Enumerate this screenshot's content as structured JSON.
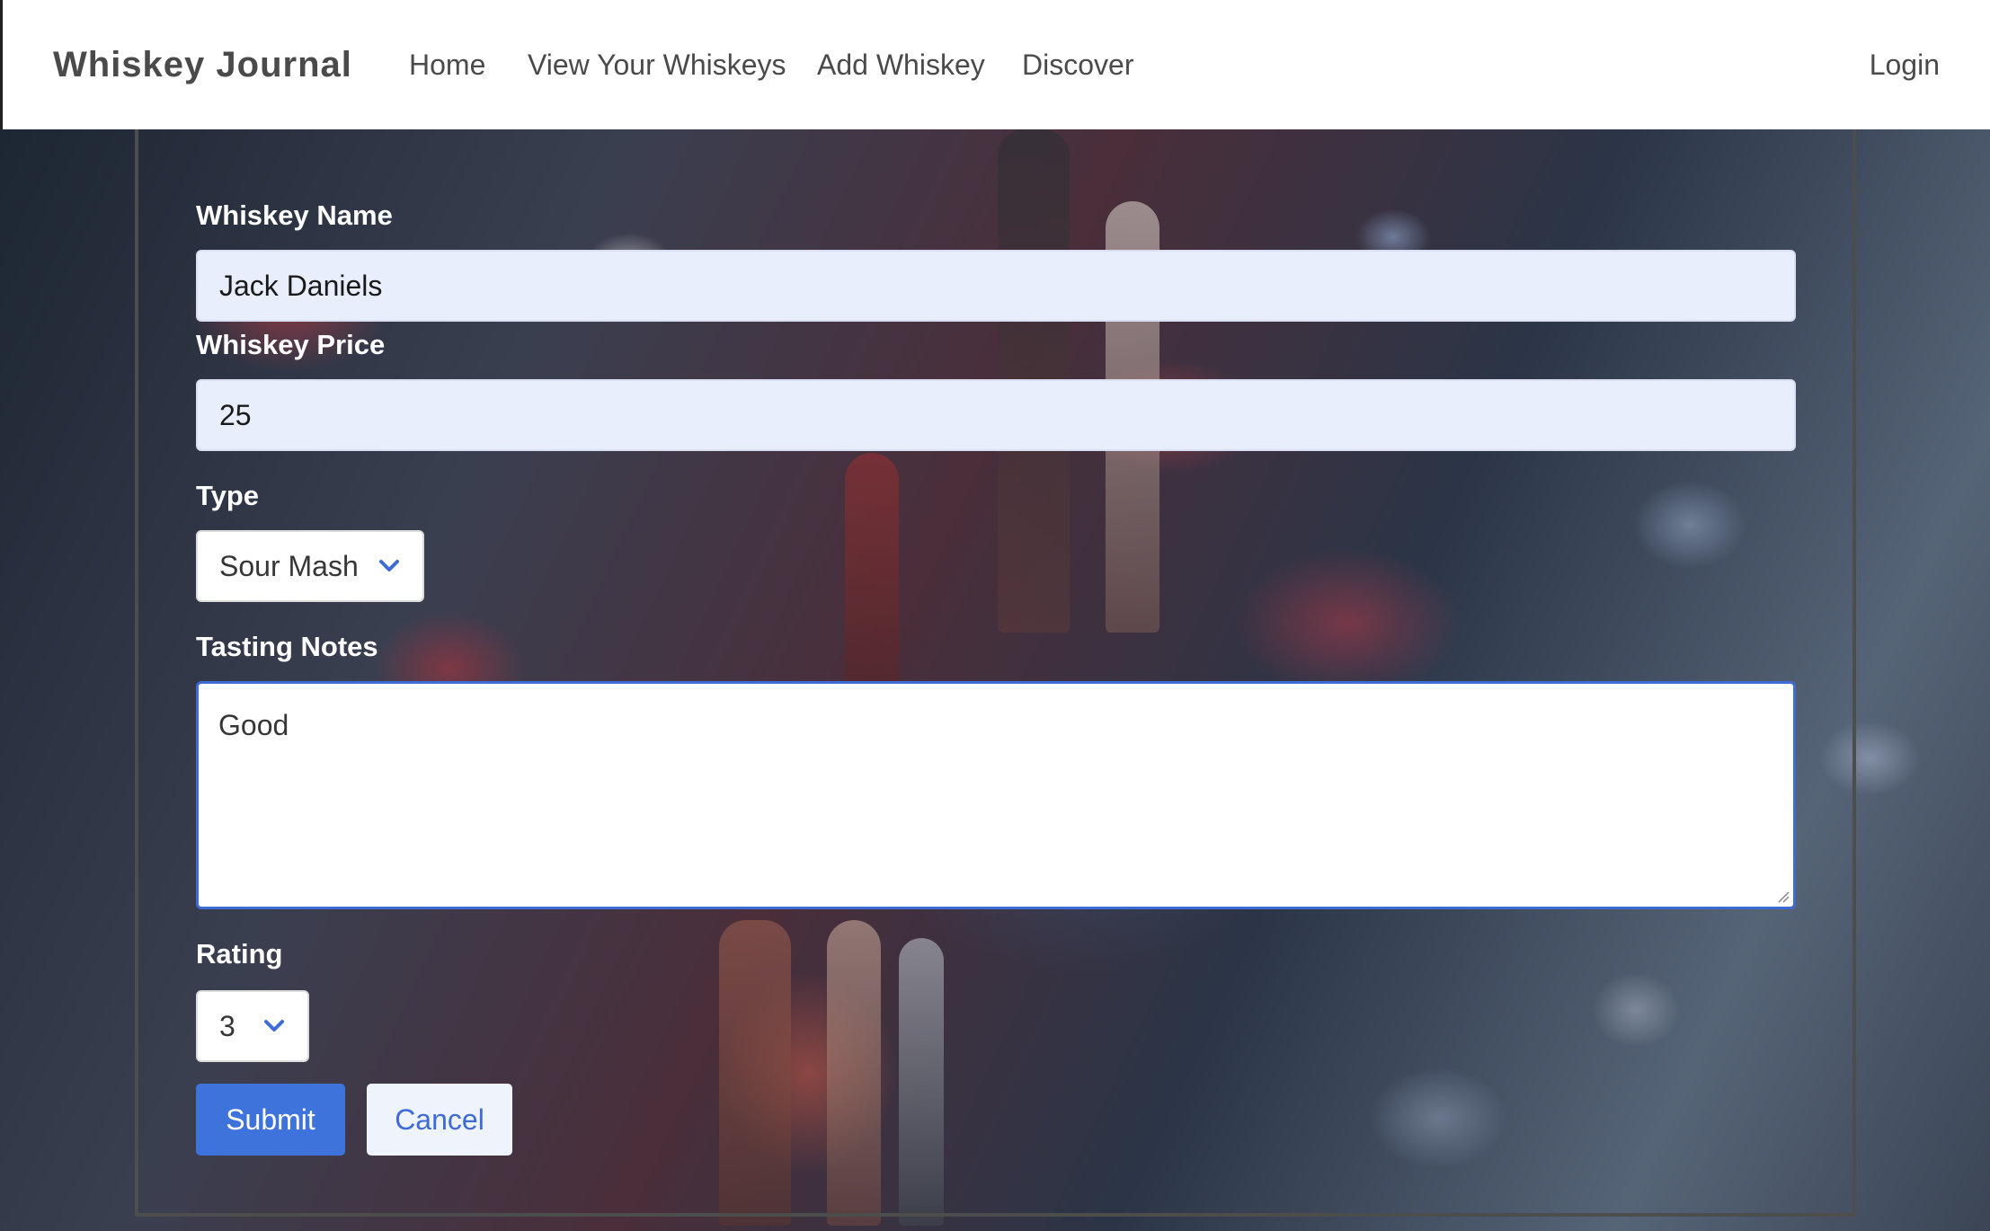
{
  "navbar": {
    "brand": "Whiskey Journal",
    "links": [
      "Home",
      "View Your Whiskeys",
      "Add Whiskey",
      "Discover"
    ],
    "login": "Login"
  },
  "form": {
    "name_label": "Whiskey Name",
    "name_value": "Jack Daniels",
    "price_label": "Whiskey Price",
    "price_value": "25",
    "type_label": "Type",
    "type_value": "Sour Mash",
    "notes_label": "Tasting Notes",
    "notes_value": "Good",
    "rating_label": "Rating",
    "rating_value": "3",
    "submit_label": "Submit",
    "cancel_label": "Cancel"
  },
  "colors": {
    "primary": "#3e73dc",
    "input_bg": "#e8eefb",
    "focus_border": "#3e6bd6"
  }
}
